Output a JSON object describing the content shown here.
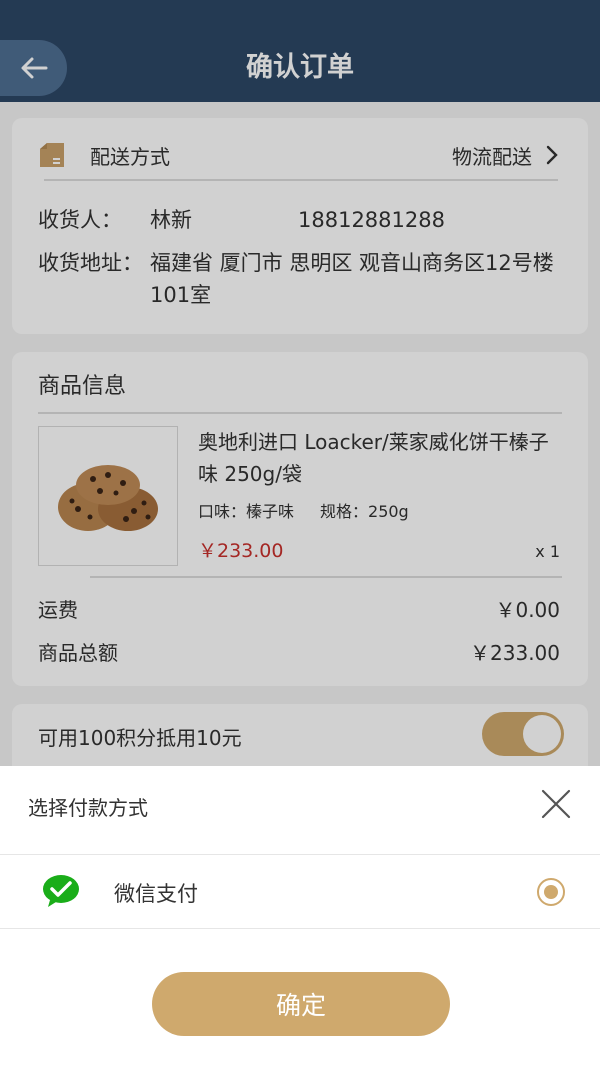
{
  "header": {
    "title": "确认订单",
    "back_icon": "arrow-left-icon"
  },
  "delivery": {
    "label": "配送方式",
    "value": "物流配送",
    "icon": "box-icon"
  },
  "address": {
    "receiver_label": "收货人：",
    "receiver_name": "林新",
    "receiver_phone": "18812881288",
    "address_label": "收货地址：",
    "address_text": "福建省 厦门市 思明区 观音山商务区12号楼101室"
  },
  "goods": {
    "section_title": "商品信息",
    "product": {
      "name": "奥地利进口 Loacker/莱家威化饼干榛子味 250g/袋",
      "flavor": "口味：榛子味",
      "spec": "规格：250g",
      "price": "￥233.00",
      "qty": "x 1"
    },
    "shipping_label": "运费",
    "shipping_value": "￥0.00",
    "total_label": "商品总额",
    "total_value": "￥233.00"
  },
  "points": {
    "label": "可用100积分抵用10元",
    "enabled": true
  },
  "payment_sheet": {
    "title": "选择付款方式",
    "method_label": "微信支付",
    "method_icon": "wechat-icon",
    "selected": true,
    "confirm_label": "确定"
  },
  "colors": {
    "header": "#2d4766",
    "accent": "#cfa96d",
    "price": "#c9302c"
  }
}
